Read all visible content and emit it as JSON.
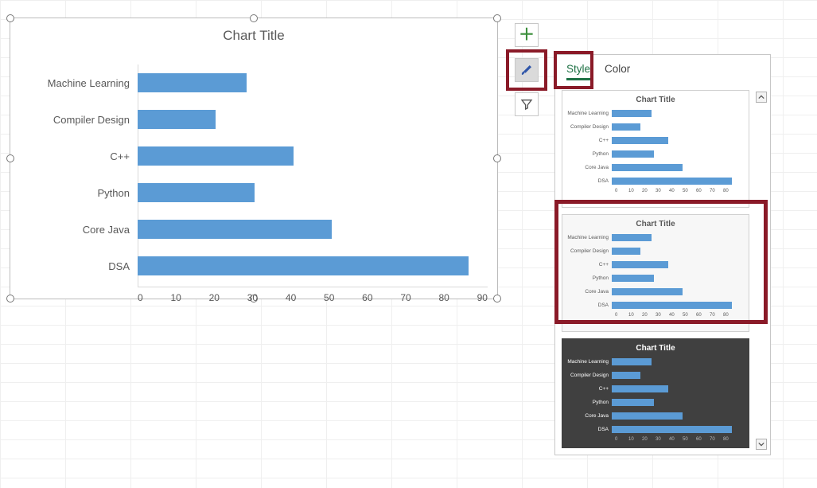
{
  "chart_data": {
    "type": "bar",
    "orientation": "horizontal",
    "title": "Chart Title",
    "categories": [
      "Machine Learning",
      "Compiler Design",
      "C++",
      "Python",
      "Core Java",
      "DSA"
    ],
    "values": [
      28,
      20,
      40,
      30,
      50,
      85
    ],
    "xlim": [
      0,
      90
    ],
    "xticks": [
      0,
      10,
      20,
      30,
      40,
      50,
      60,
      70,
      80,
      90
    ],
    "xlabel": "",
    "ylabel": ""
  },
  "side_buttons": {
    "plus": "+",
    "brush": "brush-icon",
    "filter": "filter-icon"
  },
  "pane": {
    "tabs": {
      "style": "Style",
      "color": "Color"
    },
    "preview_title": "Chart Title",
    "preview_categories": [
      "Machine Learning",
      "Compiler Design",
      "C++",
      "Python",
      "Core Java",
      "DSA"
    ],
    "preview_values": [
      28,
      20,
      40,
      30,
      50,
      85
    ],
    "preview_xticks": [
      0,
      10,
      20,
      30,
      40,
      50,
      60,
      70,
      80
    ]
  }
}
